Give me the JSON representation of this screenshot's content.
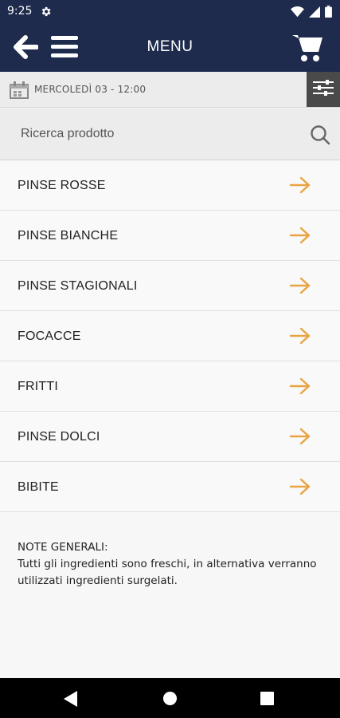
{
  "status": {
    "time": "9:25"
  },
  "header": {
    "title": "MENU"
  },
  "date": {
    "text": "MERCOLEDÌ 03 - 12:00"
  },
  "search": {
    "placeholder": "Ricerca prodotto"
  },
  "categories": [
    {
      "label": "PINSE ROSSE"
    },
    {
      "label": "PINSE BIANCHE"
    },
    {
      "label": "PINSE STAGIONALI"
    },
    {
      "label": "FOCACCE"
    },
    {
      "label": "FRITTI"
    },
    {
      "label": "PINSE DOLCI"
    },
    {
      "label": "BIBITE"
    }
  ],
  "notes": {
    "title": "NOTE GENERALI:",
    "text": "Tutti gli ingredienti sono freschi, in alternativa verranno utilizzati ingredienti surgelati."
  },
  "colors": {
    "navy": "#1e2b4d",
    "accent": "#e8a443"
  }
}
